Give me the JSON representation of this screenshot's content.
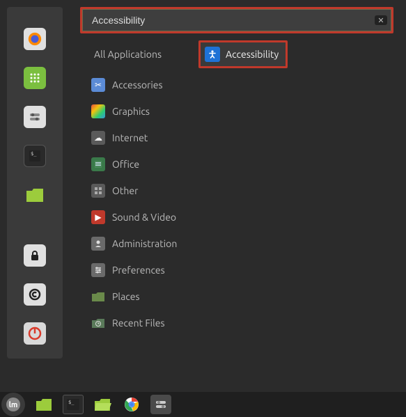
{
  "search": {
    "value": "Accessibility"
  },
  "categories": {
    "all": "All Applications",
    "items": [
      {
        "label": "Accessories"
      },
      {
        "label": "Graphics"
      },
      {
        "label": "Internet"
      },
      {
        "label": "Office"
      },
      {
        "label": "Other"
      },
      {
        "label": "Sound & Video"
      },
      {
        "label": "Administration"
      },
      {
        "label": "Preferences"
      },
      {
        "label": "Places"
      },
      {
        "label": "Recent Files"
      }
    ]
  },
  "results": {
    "items": [
      {
        "label": "Accessibility"
      }
    ]
  }
}
